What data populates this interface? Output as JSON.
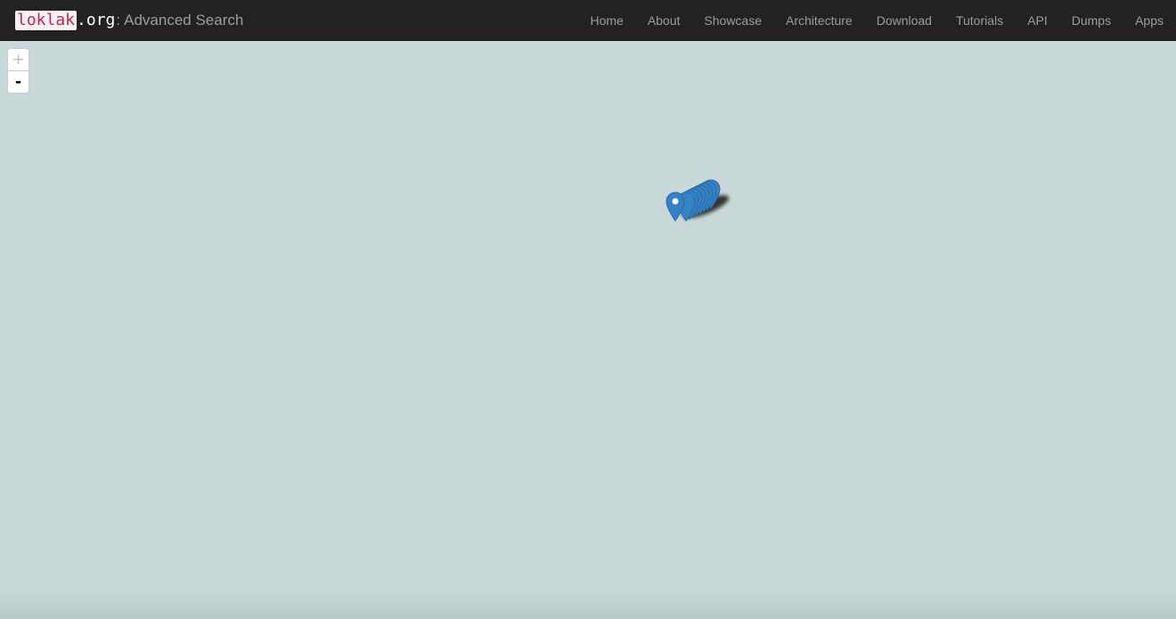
{
  "navbar": {
    "brand_highlight": "loklak",
    "brand_suffix": ".org",
    "brand_colon": ":",
    "brand_subtitle": "Advanced Search",
    "links": [
      "Home",
      "About",
      "Showcase",
      "Architecture",
      "Download",
      "Tutorials",
      "API",
      "Dumps",
      "Apps"
    ]
  },
  "map": {
    "zoom_in_label": "+",
    "zoom_out_label": "-",
    "marker_color": "#3583c7",
    "background_color": "#c8d8d9"
  }
}
